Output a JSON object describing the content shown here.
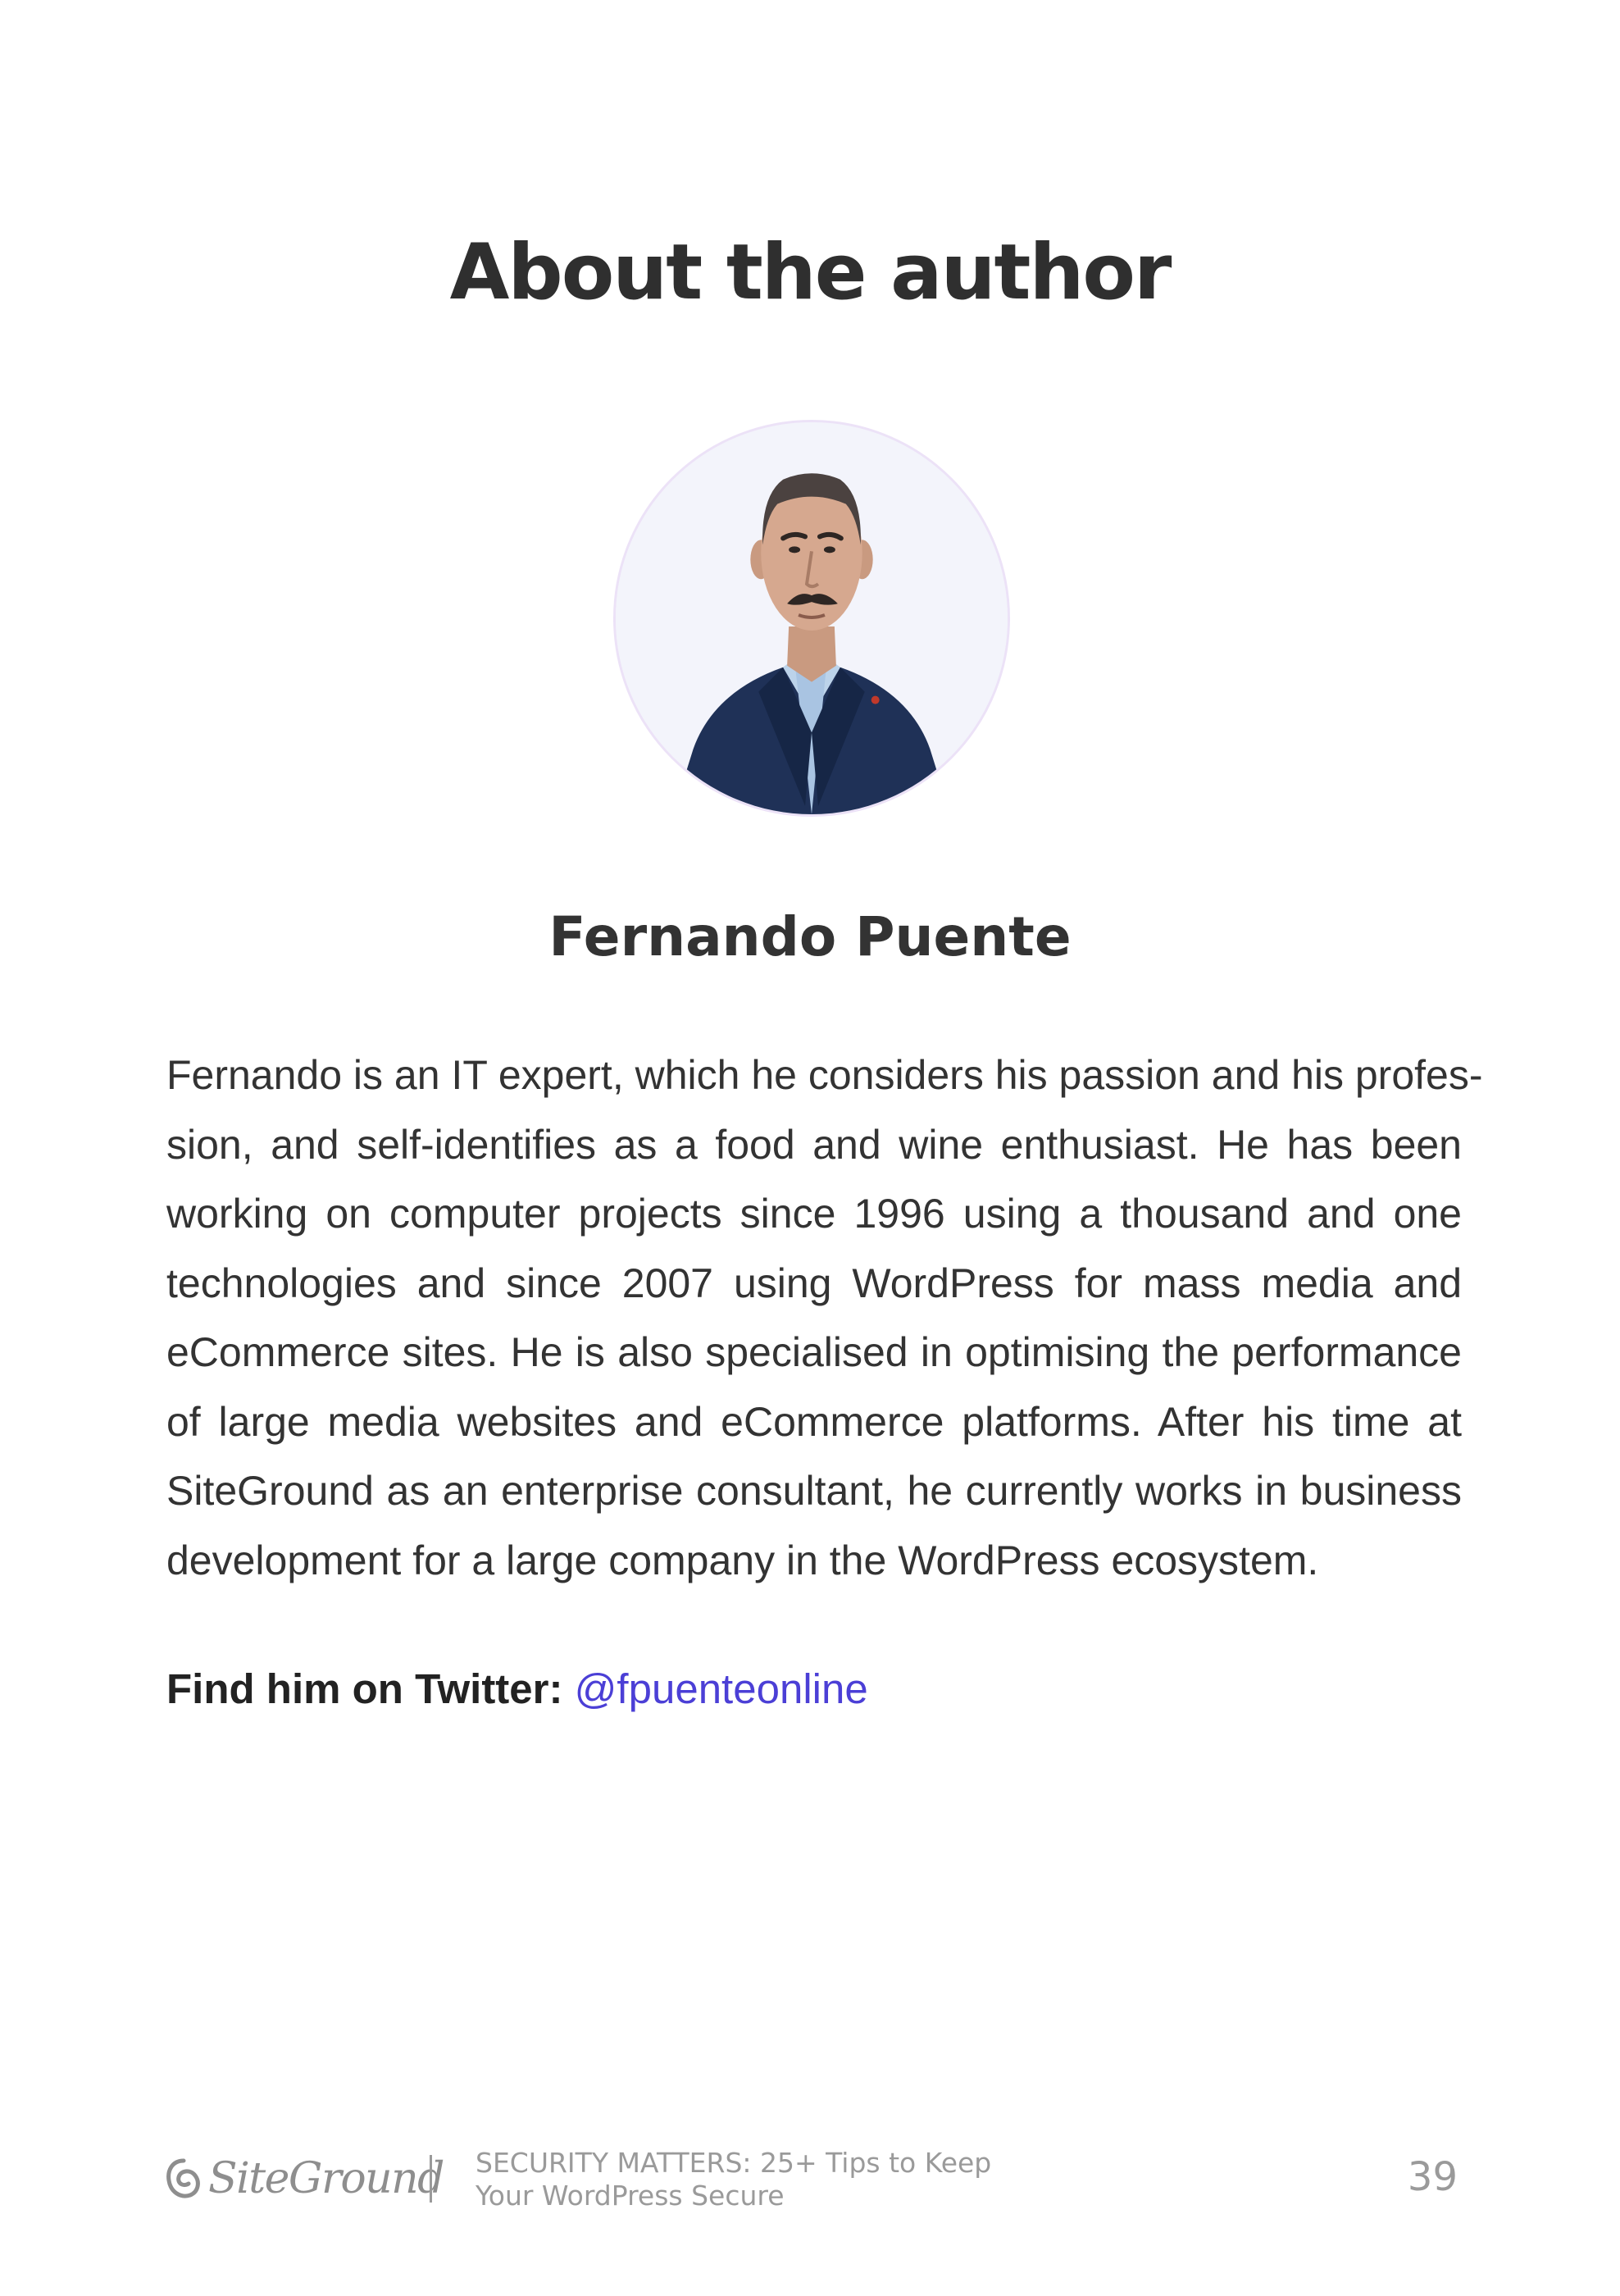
{
  "page": {
    "title": "About the author"
  },
  "author": {
    "name": "Fernando Puente",
    "bio_lines": [
      "Fernando is an IT expert, which he considers his passion and his profes-",
      "sion, and self-identifies as a food and wine enthusiast. He has been",
      "working on computer projects since 1996 using a thousand and one",
      "technologies and since 2007 using WordPress for mass media and",
      "eCommerce sites. He is also specialised in optimising the performance",
      "of large media websites and eCommerce platforms. After his time at",
      "SiteGround as an enterprise consultant, he currently works in business",
      "development for a large company in the WordPress ecosystem."
    ],
    "twitter_label": "Find him on Twitter:",
    "twitter_handle": "@fpuenteonline"
  },
  "footer": {
    "logo_text": "SiteGround",
    "book_title_line1": "SECURITY MATTERS: 25+ Tips to Keep",
    "book_title_line2": "Your WordPress Secure",
    "page_number": "39"
  },
  "colors": {
    "heading": "#2f2f2f",
    "body_text": "#333333",
    "link": "#4b3fd6",
    "footer_gray": "#9a9a9a",
    "portrait_ring": "#ece2f7"
  },
  "icons": {
    "logo_mark": "siteground-swirl-icon",
    "portrait": "author-photo"
  }
}
